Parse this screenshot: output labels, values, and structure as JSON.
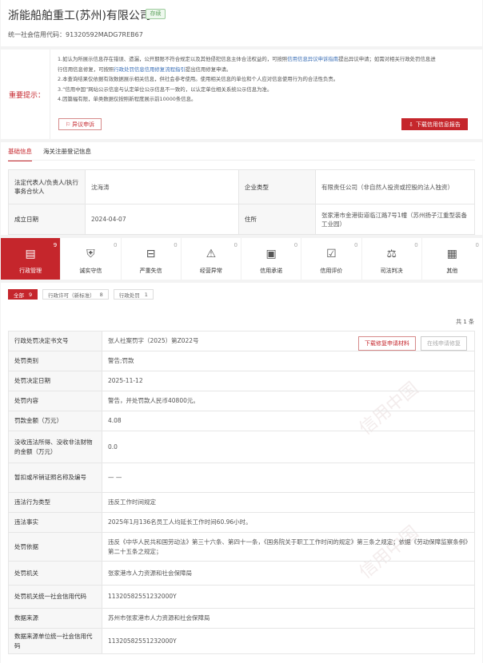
{
  "header": {
    "company_name": "浙能船舶重工(苏州)有限公司",
    "status": "存续",
    "credit_code": "统一社会信用代码：91320592MADG7REB67"
  },
  "notice": {
    "title": "重要提示：",
    "line1_a": "1.如认为所展示信息存在错误、遗漏，公开期限不符合规定以及其他侵犯信息主体合法权益的，可按照",
    "line1_link": "信用信息异议申诉指南",
    "line1_b": "提出异议申请；如需对相关行政处罚信息进",
    "line2_a": "行信用信息修复，可按照",
    "line2_link": "行政处罚信息信用修复流程指引",
    "line2_b": "提出信用修复申请。",
    "line3": "2.本查询结果仅依据有效数据展示相关信息，供社会参考使用。使用相关信息的单位和个人应对信息使用行为的合法性负责。",
    "line4": "3.“信用中国”网站公示信息与认定单位公示信息不一致的，以认定单位相关系统公示信息为准。",
    "line5": "4.因篇幅有限，单类数据仅按照新程度展示前10000条信息。",
    "objection_label": "异议申诉",
    "download_label": "下载信用信息报告"
  },
  "base": {
    "tabs": [
      "基础信息",
      "海关注册登记信息"
    ],
    "rows": [
      [
        "法定代表人/负责人/执行事务合伙人",
        "沈海涛",
        "企业类型",
        "有限责任公司（非自然人投资或控股的法人独资）"
      ],
      [
        "成立日期",
        "2024-04-07",
        "住所",
        "张家港市金港街道临江路7号1幢（苏州扬子江重型装备工业园）"
      ]
    ]
  },
  "categories": [
    {
      "label": "行政管理",
      "count": "9",
      "icon": "admin-doc-icon"
    },
    {
      "label": "诚实守信",
      "count": "0",
      "icon": "honest-shield-icon"
    },
    {
      "label": "严重失信",
      "count": "0",
      "icon": "serious-dishonest-icon"
    },
    {
      "label": "经营异常",
      "count": "0",
      "icon": "alert-light-icon"
    },
    {
      "label": "信用承诺",
      "count": "0",
      "icon": "credit-pledge-icon"
    },
    {
      "label": "信用评价",
      "count": "0",
      "icon": "credit-eval-icon"
    },
    {
      "label": "司法判决",
      "count": "0",
      "icon": "gavel-icon"
    },
    {
      "label": "其他",
      "count": "0",
      "icon": "other-icon"
    }
  ],
  "filters": [
    {
      "label": "全部",
      "count": "9"
    },
    {
      "label": "行政许可（新标准）",
      "count": "8"
    },
    {
      "label": "行政处罚",
      "count": "1"
    }
  ],
  "total": "共 1 条",
  "detail": {
    "download_fix_label": "下载修复申请材料",
    "online_fix_label": "在线申请修复",
    "rows": [
      [
        "行政处罚决定书文号",
        "张人社案罚字（2025）第Z022号"
      ],
      [
        "处罚类别",
        "警告;罚款"
      ],
      [
        "处罚决定日期",
        "2025-11-12"
      ],
      [
        "处罚内容",
        "警告，并处罚款人民币40800元。"
      ],
      [
        "罚款金额（万元）",
        "4.08"
      ],
      [
        "没收违法所得、没收非法财物的金额（万元）",
        "0.0"
      ],
      [
        "暂扣或吊销证照名称及编号",
        "— —"
      ],
      [
        "违法行为类型",
        "违反工作时间规定"
      ],
      [
        "违法事实",
        "2025年1月136名员工人均延长工作时间60.96小时。"
      ],
      [
        "处罚依据",
        "违反《中华人民共和国劳动法》第三十六条、第四十一条，《国务院关于职工工作时间的规定》第三条之规定；依据《劳动保障监察条例》第二十五条之规定；"
      ],
      [
        "处罚机关",
        "张家港市人力资源和社会保障局"
      ],
      [
        "处罚机关统一社会信用代码",
        "11320582551232000Y"
      ],
      [
        "数据来源",
        "苏州市张家港市人力资源和社会保障局"
      ],
      [
        "数据来源单位统一社会信用代码",
        "11320582551232000Y"
      ]
    ]
  },
  "colors": {
    "accent": "#c5262c",
    "status": "#5aa05a",
    "link": "#3b6fb6"
  }
}
